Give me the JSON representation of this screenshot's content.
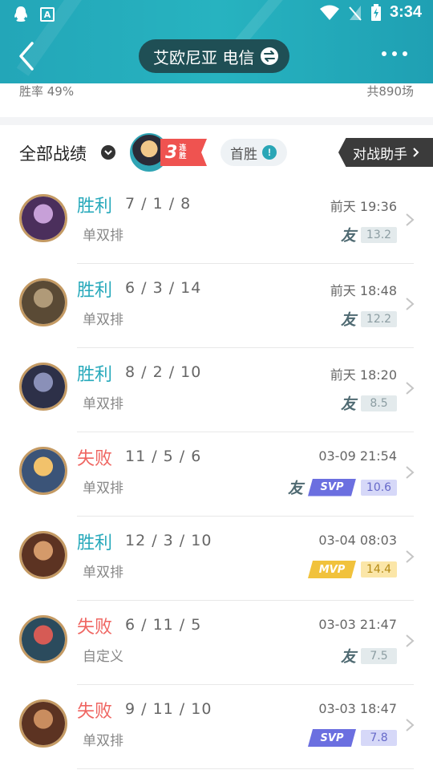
{
  "statusbar": {
    "time": "3:34"
  },
  "header": {
    "server": "艾欧尼亚 电信"
  },
  "stats": {
    "winrate": "胜率 49%",
    "total": "共890场"
  },
  "section": {
    "title": "全部战绩",
    "streak_num": "3",
    "streak_text": "连胜",
    "first_win": "首胜",
    "assistant": "对战助手"
  },
  "colors": {
    "win": "#27a9bb",
    "loss": "#ef6561",
    "teal": "#23a6b8"
  },
  "matches": [
    {
      "result": "胜利",
      "win": true,
      "kda": "7 / 1 / 8",
      "mode": "单双排",
      "time": "前天 19:36",
      "badge": "",
      "friend": true,
      "score": "13.2"
    },
    {
      "result": "胜利",
      "win": true,
      "kda": "6 / 3 / 14",
      "mode": "单双排",
      "time": "前天 18:48",
      "badge": "",
      "friend": true,
      "score": "12.2"
    },
    {
      "result": "胜利",
      "win": true,
      "kda": "8 / 2 / 10",
      "mode": "单双排",
      "time": "前天 18:20",
      "badge": "",
      "friend": true,
      "score": "8.5"
    },
    {
      "result": "失败",
      "win": false,
      "kda": "11 / 5 / 6",
      "mode": "单双排",
      "time": "03-09 21:54",
      "badge": "SVP",
      "friend": true,
      "score": "10.6"
    },
    {
      "result": "胜利",
      "win": true,
      "kda": "12 / 3 / 10",
      "mode": "单双排",
      "time": "03-04 08:03",
      "badge": "MVP",
      "friend": false,
      "score": "14.4"
    },
    {
      "result": "失败",
      "win": false,
      "kda": "6 / 11 / 5",
      "mode": "自定义",
      "time": "03-03 21:47",
      "badge": "",
      "friend": true,
      "score": "7.5"
    },
    {
      "result": "失败",
      "win": false,
      "kda": "9 / 11 / 10",
      "mode": "单双排",
      "time": "03-03 18:47",
      "badge": "SVP",
      "friend": false,
      "score": "7.8"
    }
  ],
  "labels": {
    "friend_icon": "友",
    "svp": "SVP",
    "mvp": "MVP"
  }
}
